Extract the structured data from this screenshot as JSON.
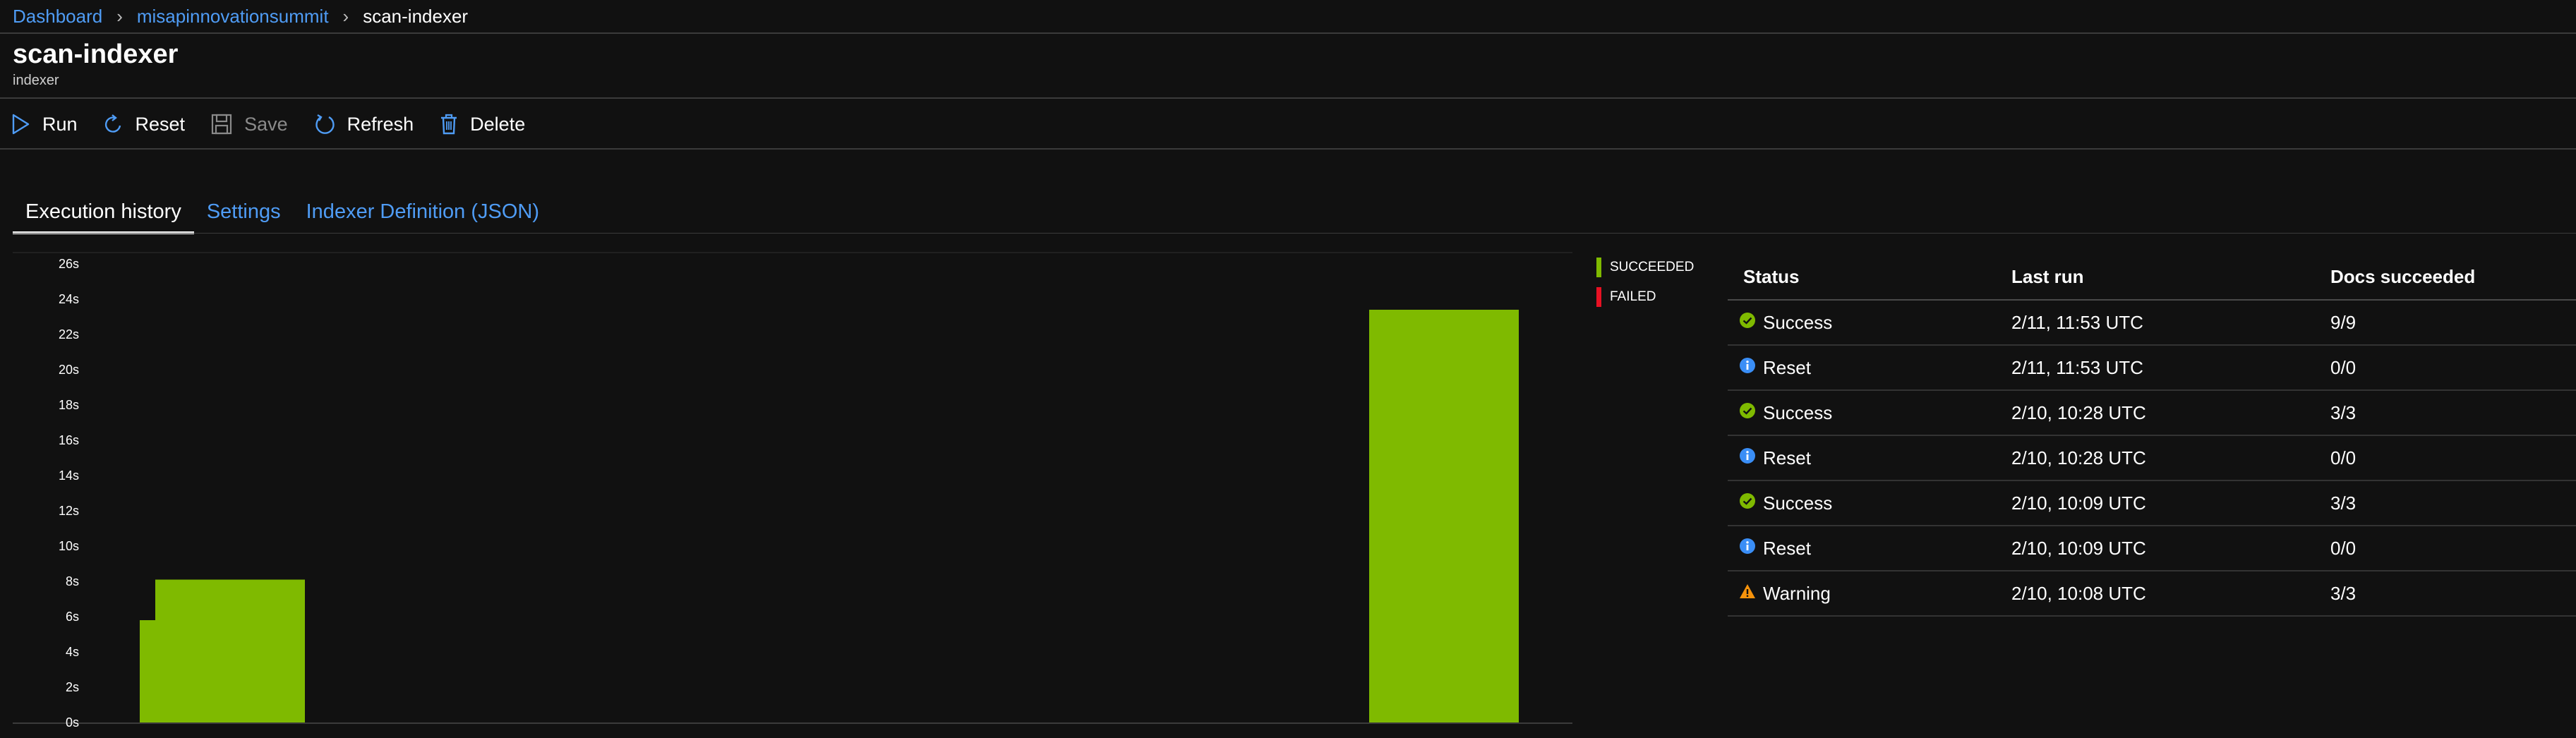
{
  "breadcrumb": {
    "items": [
      "Dashboard",
      "misapinnovationsummit"
    ],
    "current": "scan-indexer"
  },
  "header": {
    "title": "scan-indexer",
    "subtitle": "indexer"
  },
  "toolbar": {
    "run": "Run",
    "reset": "Reset",
    "save": "Save",
    "refresh": "Refresh",
    "delete": "Delete"
  },
  "tabs": [
    "Execution history",
    "Settings",
    "Indexer Definition (JSON)"
  ],
  "colors": {
    "accent": "#4f9cf5",
    "succeeded": "#7fba00",
    "failed": "#e81123",
    "info": "#3a8ef6",
    "warning": "#f7930b"
  },
  "chart_data": {
    "type": "bar",
    "ylim": [
      0,
      26
    ],
    "yticks": [
      "0s",
      "2s",
      "4s",
      "6s",
      "8s",
      "10s",
      "12s",
      "14s",
      "16s",
      "18s",
      "20s",
      "22s",
      "24s",
      "26s"
    ],
    "series": [
      {
        "name": "SUCCEEDED",
        "values": [
          5.8,
          8.1,
          23.4
        ]
      },
      {
        "name": "FAILED",
        "values": [
          0,
          0,
          0
        ]
      }
    ]
  },
  "legend": {
    "succeeded": "SUCCEEDED",
    "failed": "FAILED"
  },
  "table": {
    "headers": [
      "Status",
      "Last run",
      "Docs succeeded"
    ],
    "rows": [
      {
        "icon": "success-check-icon",
        "status": "Success",
        "last_run": "2/11, 11:53 UTC",
        "docs": "9/9"
      },
      {
        "icon": "info-icon",
        "status": "Reset",
        "last_run": "2/11, 11:53 UTC",
        "docs": "0/0"
      },
      {
        "icon": "success-check-icon",
        "status": "Success",
        "last_run": "2/10, 10:28 UTC",
        "docs": "3/3"
      },
      {
        "icon": "info-icon",
        "status": "Reset",
        "last_run": "2/10, 10:28 UTC",
        "docs": "0/0"
      },
      {
        "icon": "success-check-icon",
        "status": "Success",
        "last_run": "2/10, 10:09 UTC",
        "docs": "3/3"
      },
      {
        "icon": "info-icon",
        "status": "Reset",
        "last_run": "2/10, 10:09 UTC",
        "docs": "0/0"
      },
      {
        "icon": "warning-icon",
        "status": "Warning",
        "last_run": "2/10, 10:08 UTC",
        "docs": "3/3"
      }
    ]
  }
}
